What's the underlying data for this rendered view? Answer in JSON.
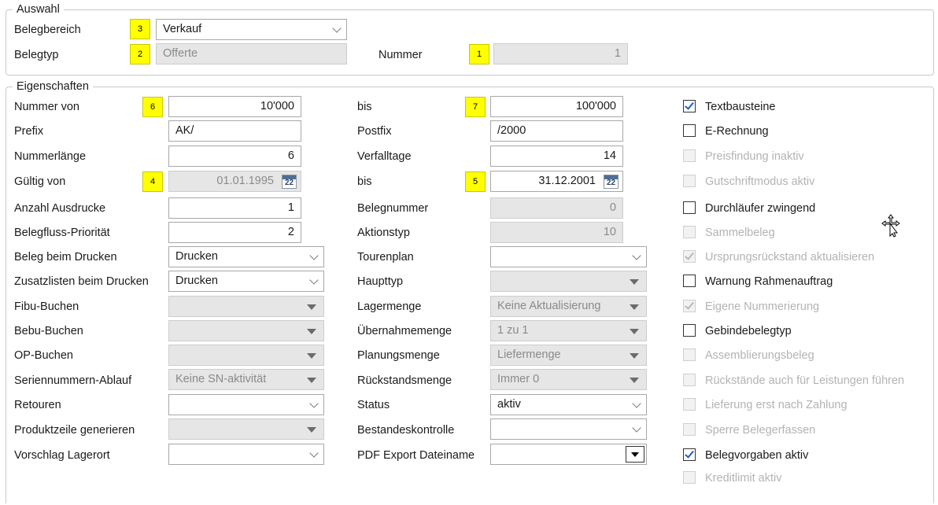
{
  "auswahl": {
    "legend": "Auswahl",
    "belegbereich_label": "Belegbereich",
    "belegbereich_badge": "3",
    "belegbereich_value": "Verkauf",
    "belegtyp_label": "Belegtyp",
    "belegtyp_badge": "2",
    "belegtyp_value": "Offerte",
    "nummer_label": "Nummer",
    "nummer_badge": "1",
    "nummer_value": "1"
  },
  "eigenschaften": {
    "legend": "Eigenschaften",
    "left": [
      {
        "label": "Nummer von",
        "badge": "6",
        "value": "10'000"
      },
      {
        "label": "Prefix",
        "value": "AK/"
      },
      {
        "label": "Nummerlänge",
        "value": "6"
      },
      {
        "label": "Gültig von",
        "badge": "4",
        "value": "01.01.1995"
      },
      {
        "label": "Anzahl Ausdrucke",
        "value": "1"
      },
      {
        "label": "Belegfluss-Priorität",
        "value": "2"
      },
      {
        "label": "Beleg beim Drucken",
        "value": "Drucken"
      },
      {
        "label": "Zusatzlisten beim Drucken",
        "value": "Drucken"
      },
      {
        "label": "Fibu-Buchen",
        "value": ""
      },
      {
        "label": "Bebu-Buchen",
        "value": ""
      },
      {
        "label": "OP-Buchen",
        "value": ""
      },
      {
        "label": "Seriennummern-Ablauf",
        "value": "Keine SN-aktivität"
      },
      {
        "label": "Retouren",
        "value": ""
      },
      {
        "label": "Produktzeile generieren",
        "value": ""
      },
      {
        "label": "Vorschlag Lagerort",
        "value": ""
      }
    ],
    "middle": [
      {
        "label": "bis",
        "badge": "7",
        "value": "100'000"
      },
      {
        "label": "Postfix",
        "value": "/2000"
      },
      {
        "label": "Verfalltage",
        "value": "14"
      },
      {
        "label": "bis",
        "badge": "5",
        "value": "31.12.2001"
      },
      {
        "label": "Belegnummer",
        "value": "0"
      },
      {
        "label": "Aktionstyp",
        "value": "10"
      },
      {
        "label": "Tourenplan",
        "value": ""
      },
      {
        "label": "Haupttyp",
        "value": ""
      },
      {
        "label": "Lagermenge",
        "value": "Keine Aktualisierung"
      },
      {
        "label": "Übernahmemenge",
        "value": "1 zu 1"
      },
      {
        "label": "Planungsmenge",
        "value": "Liefermenge"
      },
      {
        "label": "Rückstandsmenge",
        "value": "Immer 0"
      },
      {
        "label": "Status",
        "value": "aktiv"
      },
      {
        "label": "Bestandeskontrolle",
        "value": ""
      },
      {
        "label": "PDF Export Dateiname",
        "value": ""
      }
    ],
    "checkboxes": [
      {
        "label": "Textbausteine",
        "checked": true,
        "enabled": true
      },
      {
        "label": "E-Rechnung",
        "checked": false,
        "enabled": true
      },
      {
        "label": "Preisfindung inaktiv",
        "checked": false,
        "enabled": false
      },
      {
        "label": "Gutschriftmodus aktiv",
        "checked": false,
        "enabled": false
      },
      {
        "label": "Durchläufer zwingend",
        "checked": false,
        "enabled": true
      },
      {
        "label": "Sammelbeleg",
        "checked": false,
        "enabled": false
      },
      {
        "label": "Ursprungsrückstand aktualisieren",
        "checked": true,
        "enabled": false
      },
      {
        "label": "Warnung Rahmenauftrag",
        "checked": false,
        "enabled": true
      },
      {
        "label": "Eigene Nummerierung",
        "checked": true,
        "enabled": false
      },
      {
        "label": "Gebindebelegtyp",
        "checked": false,
        "enabled": true
      },
      {
        "label": "Assemblierungsbeleg",
        "checked": false,
        "enabled": false
      },
      {
        "label": "Rückstände auch für Leistungen führen",
        "checked": false,
        "enabled": false
      },
      {
        "label": "Lieferung erst nach Zahlung",
        "checked": false,
        "enabled": false
      },
      {
        "label": "Sperre Belegerfassen",
        "checked": false,
        "enabled": false
      },
      {
        "label": "Belegvorgaben aktiv",
        "checked": true,
        "enabled": true
      },
      {
        "label": "Kreditlimit aktiv",
        "checked": false,
        "enabled": false
      }
    ]
  },
  "calendar_icon_text": "22",
  "colors": {
    "badge": "#ffff00",
    "check": "#1f5fbf",
    "disabled_bg": "#e6e6e6"
  }
}
